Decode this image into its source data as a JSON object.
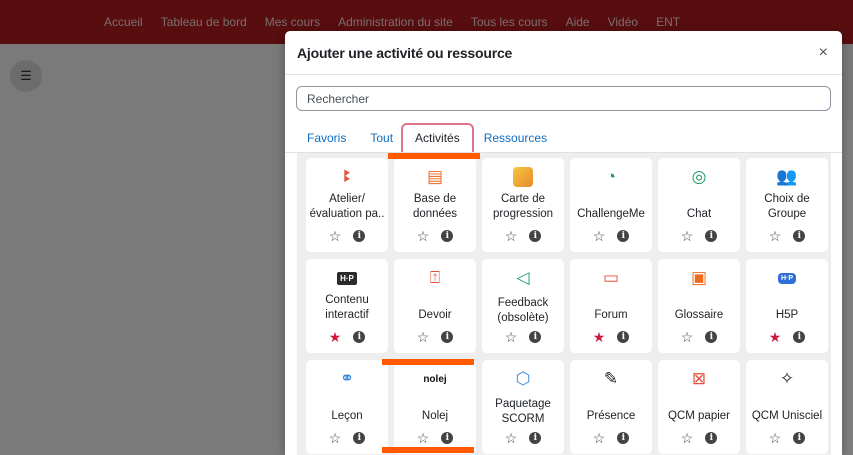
{
  "topnav": [
    "Accueil",
    "Tableau de bord",
    "Mes cours",
    "Administration du site",
    "Tous les cours",
    "Aide",
    "Vidéo",
    "ENT"
  ],
  "modal": {
    "title": "Ajouter une activité ou ressource",
    "close": "×",
    "search_placeholder": "Rechercher",
    "tabs": {
      "favoris": "Favoris",
      "tout": "Tout",
      "activites": "Activités",
      "ressources": "Ressources"
    }
  },
  "tiles": [
    {
      "label": "Atelier/ évaluation pa..",
      "icon": "workshop-icon",
      "starred": false
    },
    {
      "label": "Base de données",
      "icon": "database-icon",
      "starred": false
    },
    {
      "label": "Carte de progression",
      "icon": "map-icon",
      "starred": false
    },
    {
      "label": "ChallengeMe",
      "icon": "challenge-icon",
      "starred": false
    },
    {
      "label": "Chat",
      "icon": "chat-icon",
      "starred": false
    },
    {
      "label": "Choix de Groupe",
      "icon": "group-choice-icon",
      "starred": false
    },
    {
      "label": "Contenu interactif",
      "icon": "h5p-icon",
      "starred": true
    },
    {
      "label": "Devoir",
      "icon": "assignment-icon",
      "starred": false
    },
    {
      "label": "Feedback (obsolète)",
      "icon": "feedback-icon",
      "starred": false
    },
    {
      "label": "Forum",
      "icon": "forum-icon",
      "starred": true
    },
    {
      "label": "Glossaire",
      "icon": "glossary-icon",
      "starred": false
    },
    {
      "label": "H5P",
      "icon": "h5p-icon",
      "starred": true
    },
    {
      "label": "Leçon",
      "icon": "lesson-icon",
      "starred": false
    },
    {
      "label": "Nolej",
      "icon": "nolej-icon",
      "starred": false
    },
    {
      "label": "Paquetage SCORM",
      "icon": "scorm-icon",
      "starred": false
    },
    {
      "label": "Présence",
      "icon": "attendance-icon",
      "starred": false
    },
    {
      "label": "QCM papier",
      "icon": "paper-quiz-icon",
      "starred": false
    },
    {
      "label": "QCM Unisciel",
      "icon": "puzzle-icon",
      "starred": false
    }
  ],
  "icon_text": {
    "h5p": "H·P",
    "nolej": "nolej"
  },
  "colors": {
    "header_red": "#b01a1f",
    "link_blue": "#0f6cbf",
    "active_tab_border": "#e0748a",
    "star_active": "#d0193f",
    "highlight_orange": "#ff5a00"
  }
}
